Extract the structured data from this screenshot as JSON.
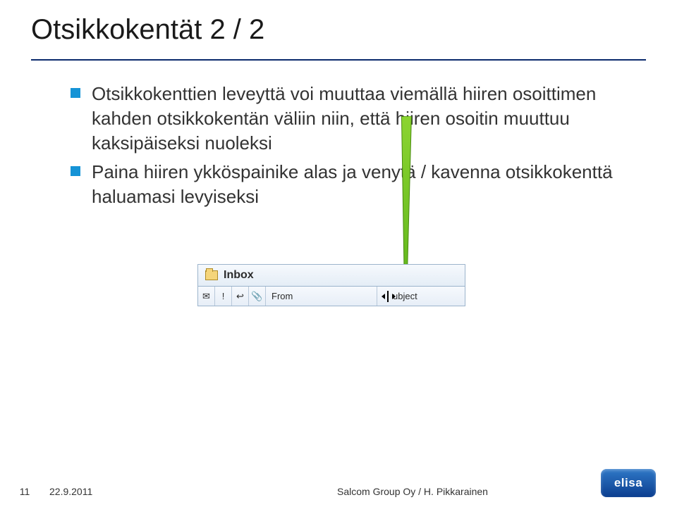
{
  "title": "Otsikkokentät 2 / 2",
  "bullets": [
    "Otsikkokenttien leveyttä voi muuttaa viemällä hiiren osoittimen kahden otsikkokentän väliin niin, että hiiren osoitin muuttuu kaksipäiseksi nuoleksi",
    "Paina hiiren ykköspainike alas ja venytä / kavenna otsikkokenttä haluamasi levyiseksi"
  ],
  "screenshot": {
    "inbox_label": "Inbox",
    "col_from": "From",
    "col_subject": "ubject",
    "icons": {
      "envelope": "✉",
      "flag": "!",
      "attach": "📎"
    }
  },
  "footer": {
    "page": "11",
    "date": "22.9.2011",
    "center": "Salcom Group Oy / H. Pikkarainen"
  },
  "logo_text": "elisa"
}
